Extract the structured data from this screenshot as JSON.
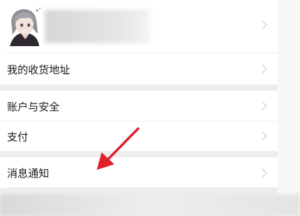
{
  "profile": {
    "avatar_icon": "anime-avatar-icon"
  },
  "menu": {
    "address": "我的收货地址",
    "account_security": "账户与安全",
    "payment": "支付",
    "notifications": "消息通知"
  },
  "icons": {
    "chevron": "chevron-right-icon",
    "annotation": "red-arrow-annotation"
  },
  "colors": {
    "arrow": "#e0202a",
    "chevron": "#c2c2c2",
    "background": "#ededed"
  }
}
